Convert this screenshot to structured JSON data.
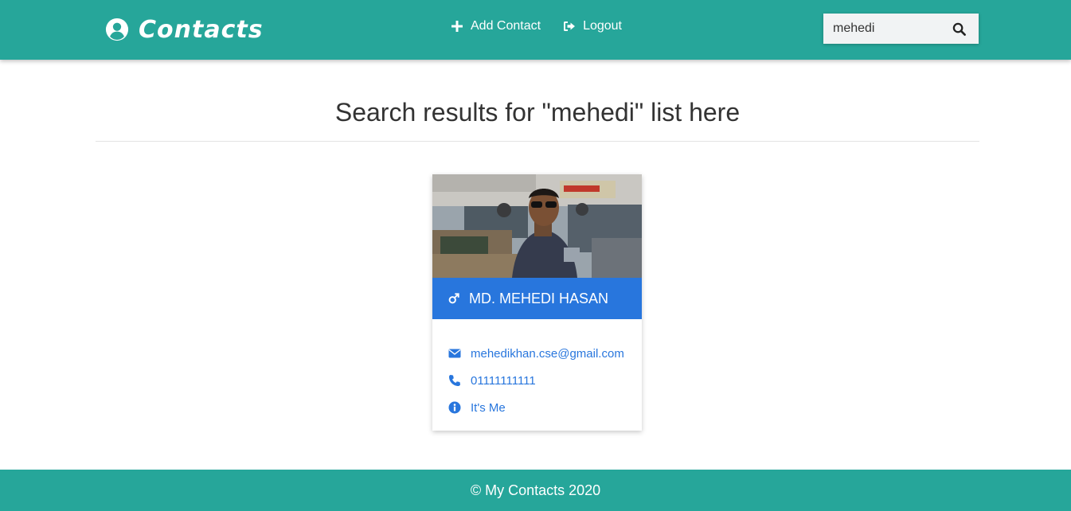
{
  "nav": {
    "brand": "Contacts",
    "links": [
      {
        "label": "Add Contact",
        "icon": "plus-icon"
      },
      {
        "label": "Logout",
        "icon": "sign-out-icon"
      }
    ],
    "search": {
      "value": "mehedi",
      "icon": "search-icon"
    }
  },
  "main": {
    "title": "Search results for \"mehedi\" list here"
  },
  "card": {
    "name": "MD. MEHEDI HASAN",
    "gender_icon": "male-icon",
    "email": "mehedikhan.cse@gmail.com",
    "phone": "01111111111",
    "description": "It's Me"
  },
  "footer": {
    "text": "© My Contacts 2020"
  },
  "colors": {
    "primary": "#26a69a",
    "accent": "#2876dd"
  }
}
